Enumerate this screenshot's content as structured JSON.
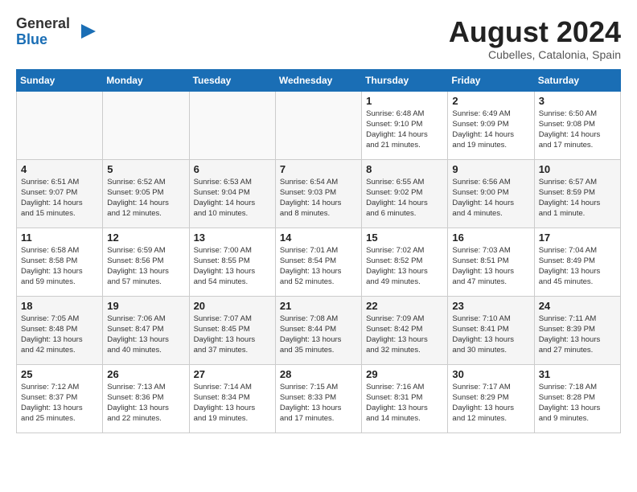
{
  "header": {
    "logo_general": "General",
    "logo_blue": "Blue",
    "month_year": "August 2024",
    "location": "Cubelles, Catalonia, Spain"
  },
  "columns": [
    "Sunday",
    "Monday",
    "Tuesday",
    "Wednesday",
    "Thursday",
    "Friday",
    "Saturday"
  ],
  "weeks": [
    {
      "days": [
        {
          "number": "",
          "info": ""
        },
        {
          "number": "",
          "info": ""
        },
        {
          "number": "",
          "info": ""
        },
        {
          "number": "",
          "info": ""
        },
        {
          "number": "1",
          "info": "Sunrise: 6:48 AM\nSunset: 9:10 PM\nDaylight: 14 hours\nand 21 minutes."
        },
        {
          "number": "2",
          "info": "Sunrise: 6:49 AM\nSunset: 9:09 PM\nDaylight: 14 hours\nand 19 minutes."
        },
        {
          "number": "3",
          "info": "Sunrise: 6:50 AM\nSunset: 9:08 PM\nDaylight: 14 hours\nand 17 minutes."
        }
      ]
    },
    {
      "days": [
        {
          "number": "4",
          "info": "Sunrise: 6:51 AM\nSunset: 9:07 PM\nDaylight: 14 hours\nand 15 minutes."
        },
        {
          "number": "5",
          "info": "Sunrise: 6:52 AM\nSunset: 9:05 PM\nDaylight: 14 hours\nand 12 minutes."
        },
        {
          "number": "6",
          "info": "Sunrise: 6:53 AM\nSunset: 9:04 PM\nDaylight: 14 hours\nand 10 minutes."
        },
        {
          "number": "7",
          "info": "Sunrise: 6:54 AM\nSunset: 9:03 PM\nDaylight: 14 hours\nand 8 minutes."
        },
        {
          "number": "8",
          "info": "Sunrise: 6:55 AM\nSunset: 9:02 PM\nDaylight: 14 hours\nand 6 minutes."
        },
        {
          "number": "9",
          "info": "Sunrise: 6:56 AM\nSunset: 9:00 PM\nDaylight: 14 hours\nand 4 minutes."
        },
        {
          "number": "10",
          "info": "Sunrise: 6:57 AM\nSunset: 8:59 PM\nDaylight: 14 hours\nand 1 minute."
        }
      ]
    },
    {
      "days": [
        {
          "number": "11",
          "info": "Sunrise: 6:58 AM\nSunset: 8:58 PM\nDaylight: 13 hours\nand 59 minutes."
        },
        {
          "number": "12",
          "info": "Sunrise: 6:59 AM\nSunset: 8:56 PM\nDaylight: 13 hours\nand 57 minutes."
        },
        {
          "number": "13",
          "info": "Sunrise: 7:00 AM\nSunset: 8:55 PM\nDaylight: 13 hours\nand 54 minutes."
        },
        {
          "number": "14",
          "info": "Sunrise: 7:01 AM\nSunset: 8:54 PM\nDaylight: 13 hours\nand 52 minutes."
        },
        {
          "number": "15",
          "info": "Sunrise: 7:02 AM\nSunset: 8:52 PM\nDaylight: 13 hours\nand 49 minutes."
        },
        {
          "number": "16",
          "info": "Sunrise: 7:03 AM\nSunset: 8:51 PM\nDaylight: 13 hours\nand 47 minutes."
        },
        {
          "number": "17",
          "info": "Sunrise: 7:04 AM\nSunset: 8:49 PM\nDaylight: 13 hours\nand 45 minutes."
        }
      ]
    },
    {
      "days": [
        {
          "number": "18",
          "info": "Sunrise: 7:05 AM\nSunset: 8:48 PM\nDaylight: 13 hours\nand 42 minutes."
        },
        {
          "number": "19",
          "info": "Sunrise: 7:06 AM\nSunset: 8:47 PM\nDaylight: 13 hours\nand 40 minutes."
        },
        {
          "number": "20",
          "info": "Sunrise: 7:07 AM\nSunset: 8:45 PM\nDaylight: 13 hours\nand 37 minutes."
        },
        {
          "number": "21",
          "info": "Sunrise: 7:08 AM\nSunset: 8:44 PM\nDaylight: 13 hours\nand 35 minutes."
        },
        {
          "number": "22",
          "info": "Sunrise: 7:09 AM\nSunset: 8:42 PM\nDaylight: 13 hours\nand 32 minutes."
        },
        {
          "number": "23",
          "info": "Sunrise: 7:10 AM\nSunset: 8:41 PM\nDaylight: 13 hours\nand 30 minutes."
        },
        {
          "number": "24",
          "info": "Sunrise: 7:11 AM\nSunset: 8:39 PM\nDaylight: 13 hours\nand 27 minutes."
        }
      ]
    },
    {
      "days": [
        {
          "number": "25",
          "info": "Sunrise: 7:12 AM\nSunset: 8:37 PM\nDaylight: 13 hours\nand 25 minutes."
        },
        {
          "number": "26",
          "info": "Sunrise: 7:13 AM\nSunset: 8:36 PM\nDaylight: 13 hours\nand 22 minutes."
        },
        {
          "number": "27",
          "info": "Sunrise: 7:14 AM\nSunset: 8:34 PM\nDaylight: 13 hours\nand 19 minutes."
        },
        {
          "number": "28",
          "info": "Sunrise: 7:15 AM\nSunset: 8:33 PM\nDaylight: 13 hours\nand 17 minutes."
        },
        {
          "number": "29",
          "info": "Sunrise: 7:16 AM\nSunset: 8:31 PM\nDaylight: 13 hours\nand 14 minutes."
        },
        {
          "number": "30",
          "info": "Sunrise: 7:17 AM\nSunset: 8:29 PM\nDaylight: 13 hours\nand 12 minutes."
        },
        {
          "number": "31",
          "info": "Sunrise: 7:18 AM\nSunset: 8:28 PM\nDaylight: 13 hours\nand 9 minutes."
        }
      ]
    }
  ]
}
